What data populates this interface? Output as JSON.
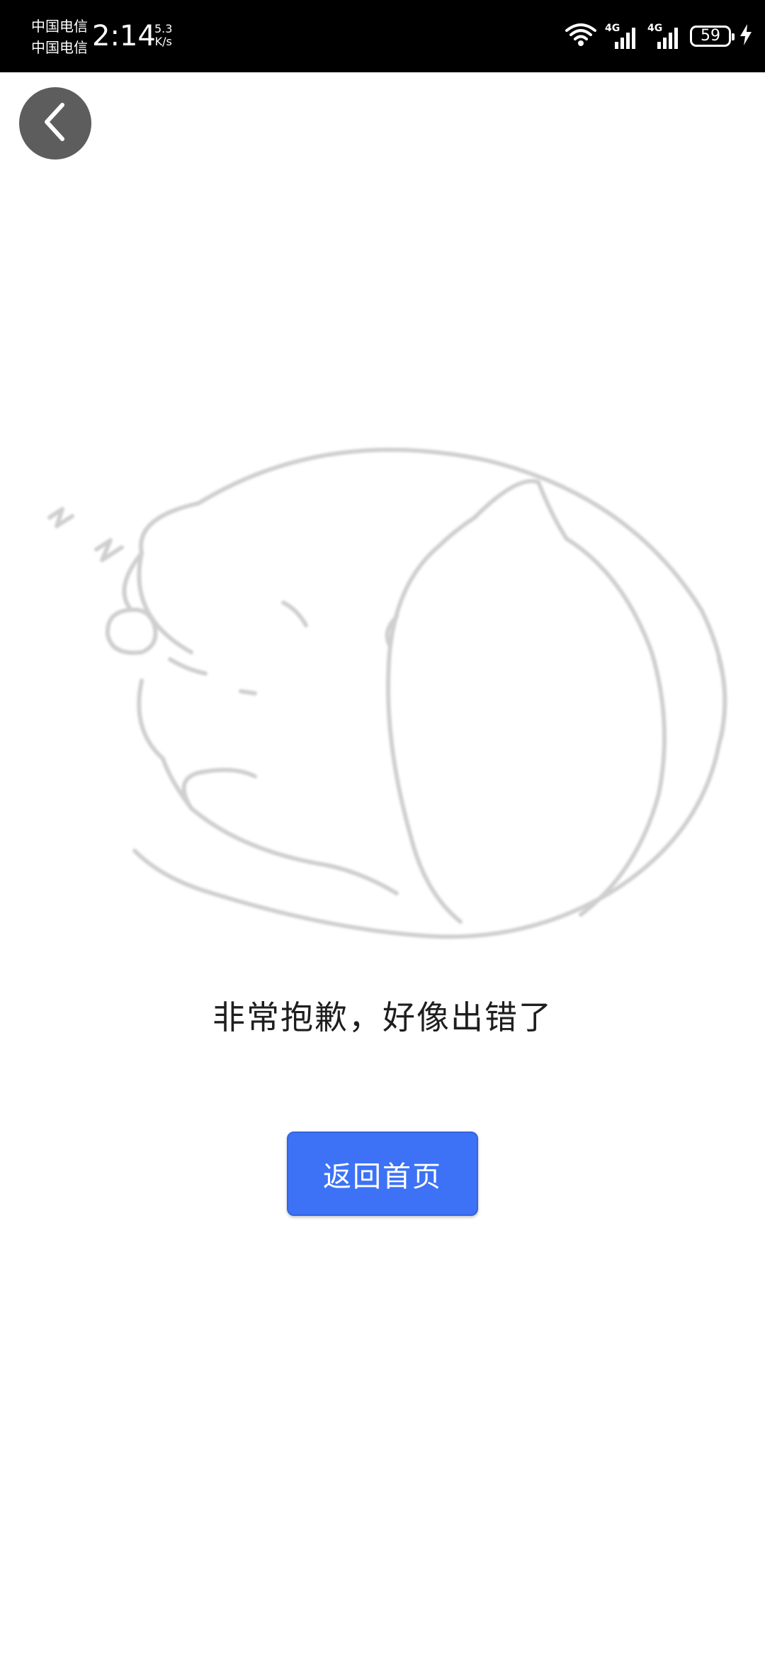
{
  "status_bar": {
    "carrier_1": "中国电信",
    "carrier_2": "中国电信",
    "time": "2:14",
    "net_speed_value": "5.3",
    "net_speed_unit": "K/s",
    "signal_1_label": "4G",
    "signal_2_label": "4G",
    "battery_level": "59",
    "icons": [
      "wifi-icon",
      "signal-icon",
      "signal-icon",
      "battery-icon",
      "charging-icon"
    ]
  },
  "nav": {
    "back_icon": "chevron-left-icon"
  },
  "error": {
    "message": "非常抱歉，好像出错了",
    "illustration": "sleeping-cat-illustration"
  },
  "actions": {
    "home_button_label": "返回首页"
  },
  "colors": {
    "status_bar_bg": "#000000",
    "back_button_bg": "#5d5d5d",
    "primary_button": "#3d72f6",
    "illustration_stroke": "#cfcfcf"
  }
}
